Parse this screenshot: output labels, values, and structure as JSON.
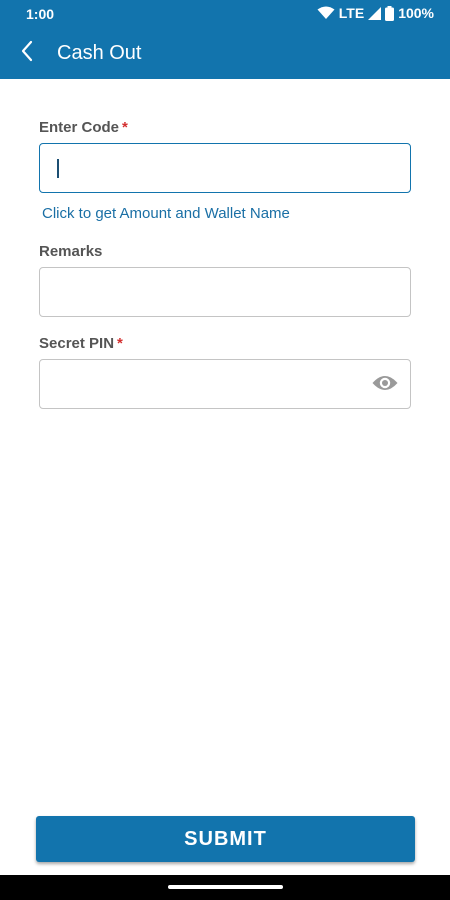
{
  "status_bar": {
    "time": "1:00",
    "network": "LTE",
    "battery": "100%",
    "icons": [
      "wifi-icon",
      "signal-icon",
      "battery-icon"
    ]
  },
  "app_bar": {
    "title": "Cash Out",
    "back_icon": "chevron-left-icon"
  },
  "form": {
    "enter_code": {
      "label": "Enter Code",
      "required_mark": "*",
      "value": "",
      "placeholder": ""
    },
    "get_amount_link": "Click to get Amount and Wallet Name",
    "remarks": {
      "label": "Remarks",
      "value": "",
      "placeholder": ""
    },
    "secret_pin": {
      "label": "Secret PIN",
      "required_mark": "*",
      "value": "",
      "placeholder": "",
      "toggle_icon": "eye-icon"
    }
  },
  "submit_label": "SUBMIT",
  "colors": {
    "primary": "#1274ad",
    "required": "#d32f2f",
    "link": "#1a6fa5",
    "label": "#555555",
    "border": "#c4c4c4"
  }
}
